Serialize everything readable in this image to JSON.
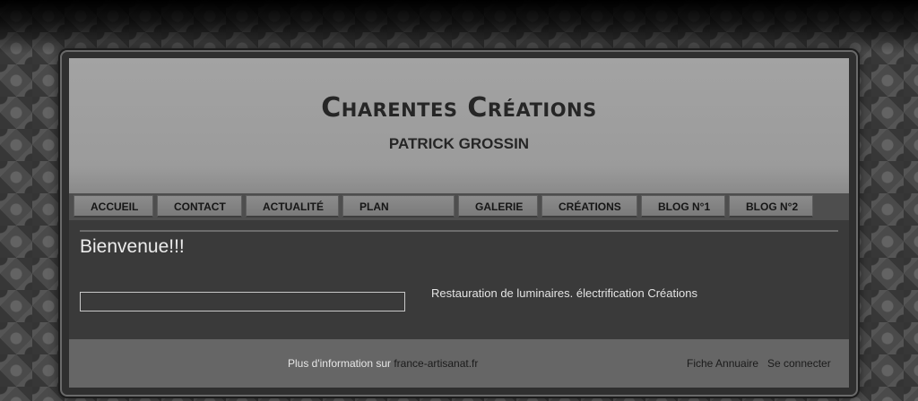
{
  "header": {
    "title": "Charentes Créations",
    "subtitle": "PATRICK GROSSIN"
  },
  "nav": {
    "items": [
      {
        "label": "ACCUEIL"
      },
      {
        "label": "CONTACT"
      },
      {
        "label": "ACTUALITÉ"
      },
      {
        "label": "PLAN"
      },
      {
        "label": "GALERIE"
      },
      {
        "label": "CRÉATIONS"
      },
      {
        "label": "BLOG N°1"
      },
      {
        "label": "BLOG N°2"
      }
    ]
  },
  "main": {
    "heading": "Bienvenue!!!",
    "description": "Restauration de luminaires. électrification Créations"
  },
  "footer": {
    "info_prefix": "Plus d'information sur ",
    "info_link": "france-artisanat.fr",
    "links": [
      {
        "label": "Fiche Annuaire"
      },
      {
        "label": "Se connecter"
      }
    ]
  }
}
